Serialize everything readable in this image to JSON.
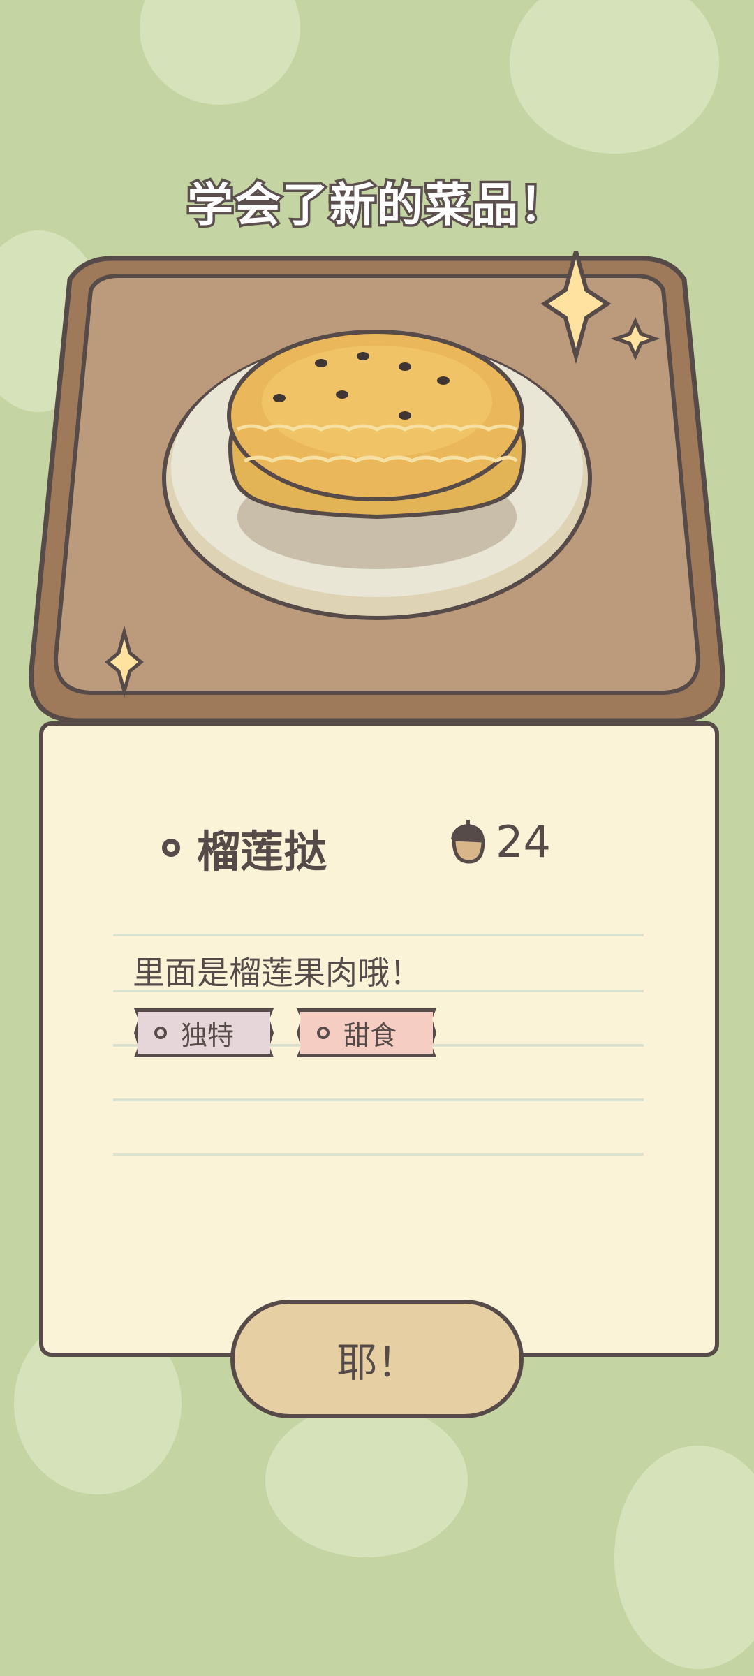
{
  "header": {
    "title": "学会了新的菜品！"
  },
  "dish": {
    "name": "榴莲挞",
    "price": "24",
    "description": "里面是榴莲果肉哦！",
    "tags": [
      {
        "label": "独特",
        "color": "#e6d6d9"
      },
      {
        "label": "甜食",
        "color": "#f6cdc2"
      }
    ]
  },
  "actions": {
    "confirm_label": "耶！"
  },
  "colors": {
    "background": "#c5d4a3",
    "card": "#fbf3d8",
    "outline": "#574b4a",
    "button": "#e6cfa3"
  },
  "icons": {
    "currency": "acorn-icon",
    "bullet": "ring-dot-icon",
    "sparkle": "sparkle-icon"
  }
}
